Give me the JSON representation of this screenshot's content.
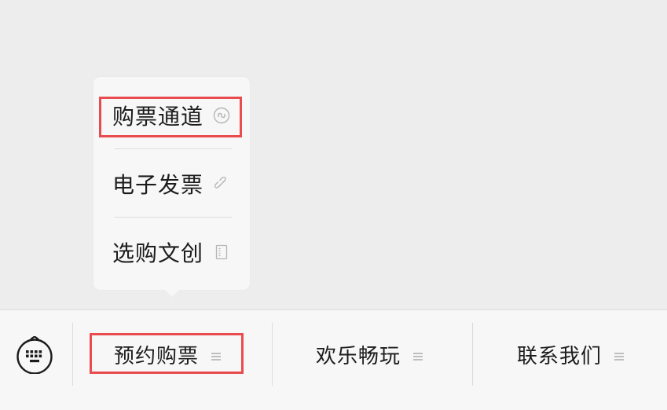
{
  "popup_menu": {
    "items": [
      {
        "label": "购票通道",
        "icon": "mini-program-icon",
        "highlighted": true
      },
      {
        "label": "电子发票",
        "icon": "link-icon",
        "highlighted": false
      },
      {
        "label": "选购文创",
        "icon": "page-icon",
        "highlighted": false
      }
    ]
  },
  "bottom_menu": {
    "keyboard_icon": "keyboard-icon",
    "tabs": [
      {
        "label": "预约购票",
        "icon": "submenu-lines-icon",
        "highlighted": true
      },
      {
        "label": "欢乐畅玩",
        "icon": "submenu-lines-icon",
        "highlighted": false
      },
      {
        "label": "联系我们",
        "icon": "submenu-lines-icon",
        "highlighted": false
      }
    ]
  },
  "colors": {
    "background": "#ededed",
    "panel": "#f7f7f7",
    "highlight_border": "#e84c4f",
    "text": "#1c1c1c",
    "icon_gray": "#b5b5b5"
  }
}
